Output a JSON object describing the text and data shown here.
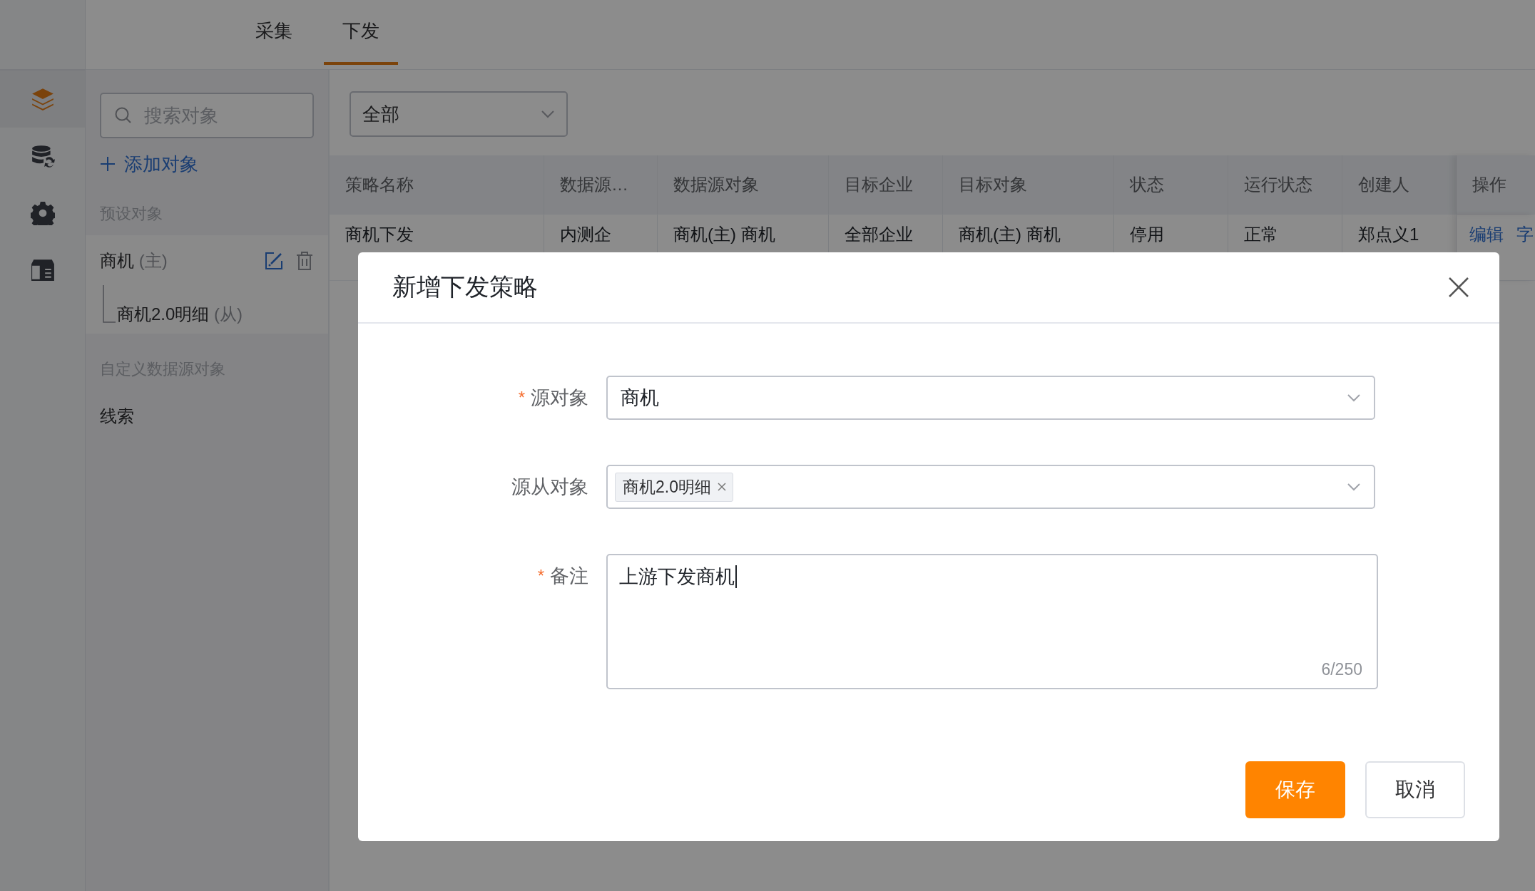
{
  "sidebar": {
    "icons": [
      {
        "kind": "layers",
        "selected": true
      },
      {
        "kind": "database-sync",
        "selected": false
      },
      {
        "kind": "gear",
        "selected": false
      },
      {
        "kind": "table",
        "selected": false
      }
    ]
  },
  "tabs": [
    {
      "label": "采集",
      "selected": false
    },
    {
      "label": "下发",
      "selected": true
    }
  ],
  "object_panel": {
    "search": {
      "placeholder": "搜索对象"
    },
    "add_button": "添加对象",
    "sections": [
      {
        "title": "预设对象",
        "items": [
          {
            "label": "商机",
            "suffix": "(主)",
            "selected": true,
            "children": [
              {
                "label": "商机2.0明细",
                "suffix": "(从)"
              }
            ]
          }
        ]
      },
      {
        "title": "自定义数据源对象",
        "items": [
          {
            "label": "线索",
            "selected": false
          }
        ]
      }
    ]
  },
  "filter": {
    "value": "全部"
  },
  "table": {
    "columns": [
      "策略名称",
      "数据源…",
      "数据源对象",
      "目标企业",
      "目标对象",
      "状态",
      "运行状态",
      "创建人",
      "操作"
    ],
    "rows": [
      {
        "cells": [
          "商机下发",
          "内测企",
          "商机(主) 商机",
          "全部企业",
          "商机(主) 商机",
          "停用",
          "正常",
          "郑点义1"
        ],
        "actions": [
          "编辑",
          "字"
        ]
      }
    ]
  },
  "modal": {
    "title": "新增下发策略",
    "fields": [
      {
        "kind": "select",
        "required_mark": "*",
        "label": "源对象",
        "value": "商机"
      },
      {
        "kind": "tags",
        "label": "源从对象",
        "tags": [
          "商机2.0明细"
        ]
      },
      {
        "kind": "textarea",
        "required_mark": "*",
        "label": "备注",
        "value": "上游下发商机",
        "counter": "6/250"
      }
    ],
    "buttons": [
      {
        "label": "保存",
        "kind": "primary"
      },
      {
        "label": "取消",
        "kind": "default"
      }
    ]
  }
}
